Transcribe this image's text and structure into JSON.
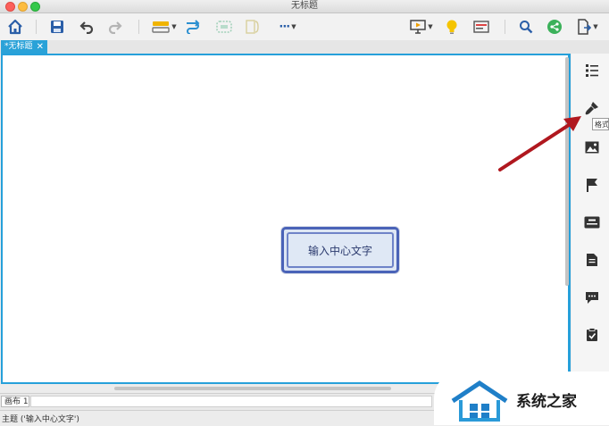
{
  "window": {
    "title": "无标题"
  },
  "toolbar": {
    "buttons": [
      {
        "name": "home-icon"
      },
      {
        "name": "save-icon"
      },
      {
        "name": "undo-icon"
      },
      {
        "name": "redo-icon"
      },
      {
        "name": "insert-topic-icon"
      },
      {
        "name": "relationship-icon"
      },
      {
        "name": "boundary-icon"
      },
      {
        "name": "summary-icon"
      },
      {
        "name": "more-icon"
      },
      {
        "name": "presentation-icon"
      },
      {
        "name": "lightbulb-icon"
      },
      {
        "name": "outline-icon"
      },
      {
        "name": "search-icon"
      },
      {
        "name": "share-icon"
      },
      {
        "name": "export-icon"
      }
    ],
    "more_label": "···"
  },
  "tabs": [
    {
      "label": "*无标题",
      "close": "✕"
    }
  ],
  "canvas": {
    "central_topic": "输入中心文字",
    "accent_color": "#26a0da",
    "topic_border_color": "#4a63b8",
    "topic_fill_color": "#dde6f4"
  },
  "side_panel": {
    "icons": [
      "outline-panel-icon",
      "format-brush-icon",
      "image-icon",
      "marker-flag-icon",
      "text-style-icon",
      "notes-icon",
      "comment-icon",
      "task-icon"
    ],
    "tooltip": "格式"
  },
  "sheets": {
    "tab": "画布 1"
  },
  "status": {
    "text": "主题 ('输入中心文字')"
  },
  "watermark": {
    "text": "系统之家"
  }
}
